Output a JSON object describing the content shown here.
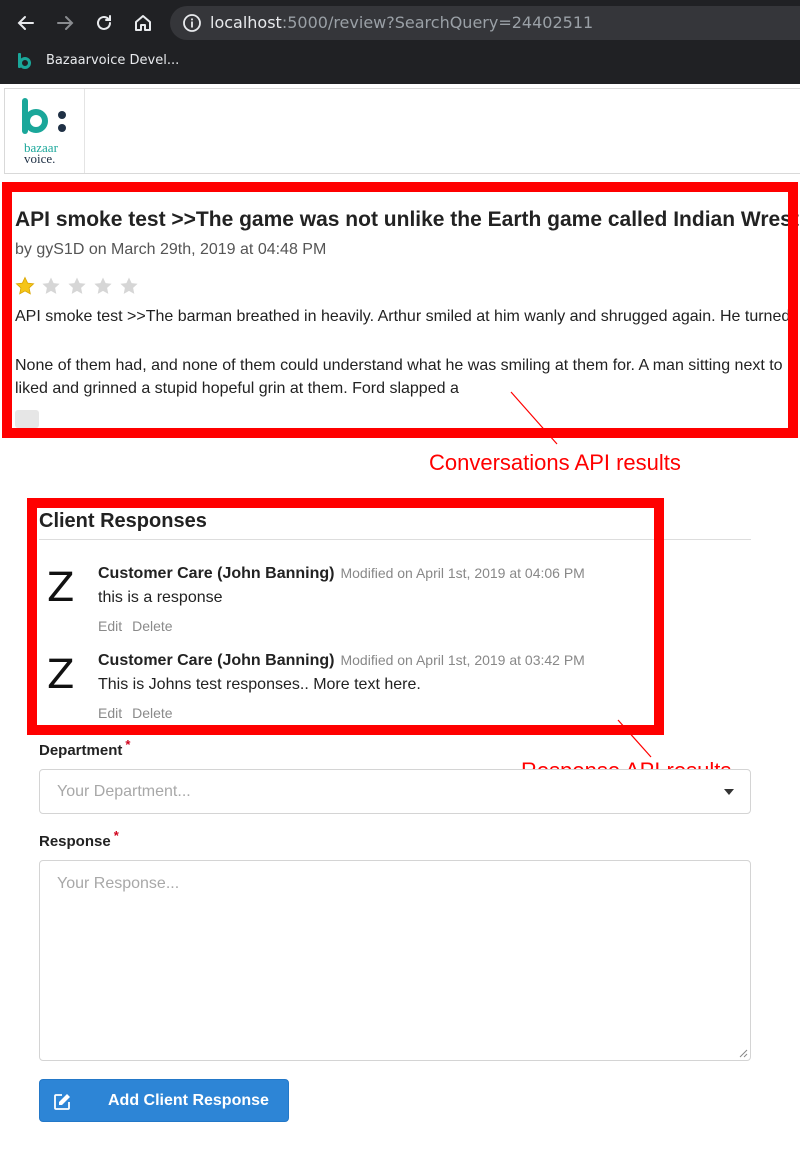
{
  "browser": {
    "url_host": "localhost",
    "url_rest": ":5000/review?SearchQuery=24402511",
    "bookmark_label": "Bazaarvoice Devel...",
    "icons": [
      "back-arrow-icon",
      "forward-arrow-icon",
      "reload-icon",
      "home-icon",
      "info-icon",
      "bazaarvoice-favicon-icon"
    ]
  },
  "header": {
    "logo_line1": "bazaar",
    "logo_line2": "voice."
  },
  "review": {
    "title": "API smoke test >>The game was not unlike the Earth game called Indian Wrestling",
    "meta": "by gyS1D on March 29th, 2019 at 04:48 PM",
    "rating": 1,
    "rating_max": 5,
    "paragraph1": "API smoke test >>The barman breathed in heavily. Arthur smiled at him wanly and shrugged again. He turned",
    "paragraph2_line1": "None of them had, and none of them could understand what he was smiling at them for. A man sitting next to",
    "paragraph2_line2": "liked and grinned a stupid hopeful grin at them. Ford slapped a"
  },
  "annotations": {
    "conversations": "Conversations API results",
    "responses": "Response API results",
    "color": "#ff0000"
  },
  "client_responses": {
    "heading": "Client Responses",
    "items": [
      {
        "avatar": "Z",
        "author": "Customer Care (John Banning)",
        "modified": "Modified on April 1st, 2019 at 04:06 PM",
        "text": "this is a response",
        "edit_label": "Edit",
        "delete_label": "Delete"
      },
      {
        "avatar": "Z",
        "author": "Customer Care (John Banning)",
        "modified": "Modified on April 1st, 2019 at 03:42 PM",
        "text": "This is Johns test responses.. More text here.",
        "edit_label": "Edit",
        "delete_label": "Delete"
      }
    ]
  },
  "form": {
    "department_label": "Department",
    "department_placeholder": "Your Department...",
    "response_label": "Response",
    "response_placeholder": "Your Response...",
    "required_mark": "*",
    "submit_label": "Add Client Response",
    "submit_color": "#2d85d6"
  },
  "colors": {
    "logo_teal": "#1aa79a",
    "logo_navy": "#1f3045",
    "star_filled": "#f5c518",
    "star_empty": "#d6d6d6"
  }
}
